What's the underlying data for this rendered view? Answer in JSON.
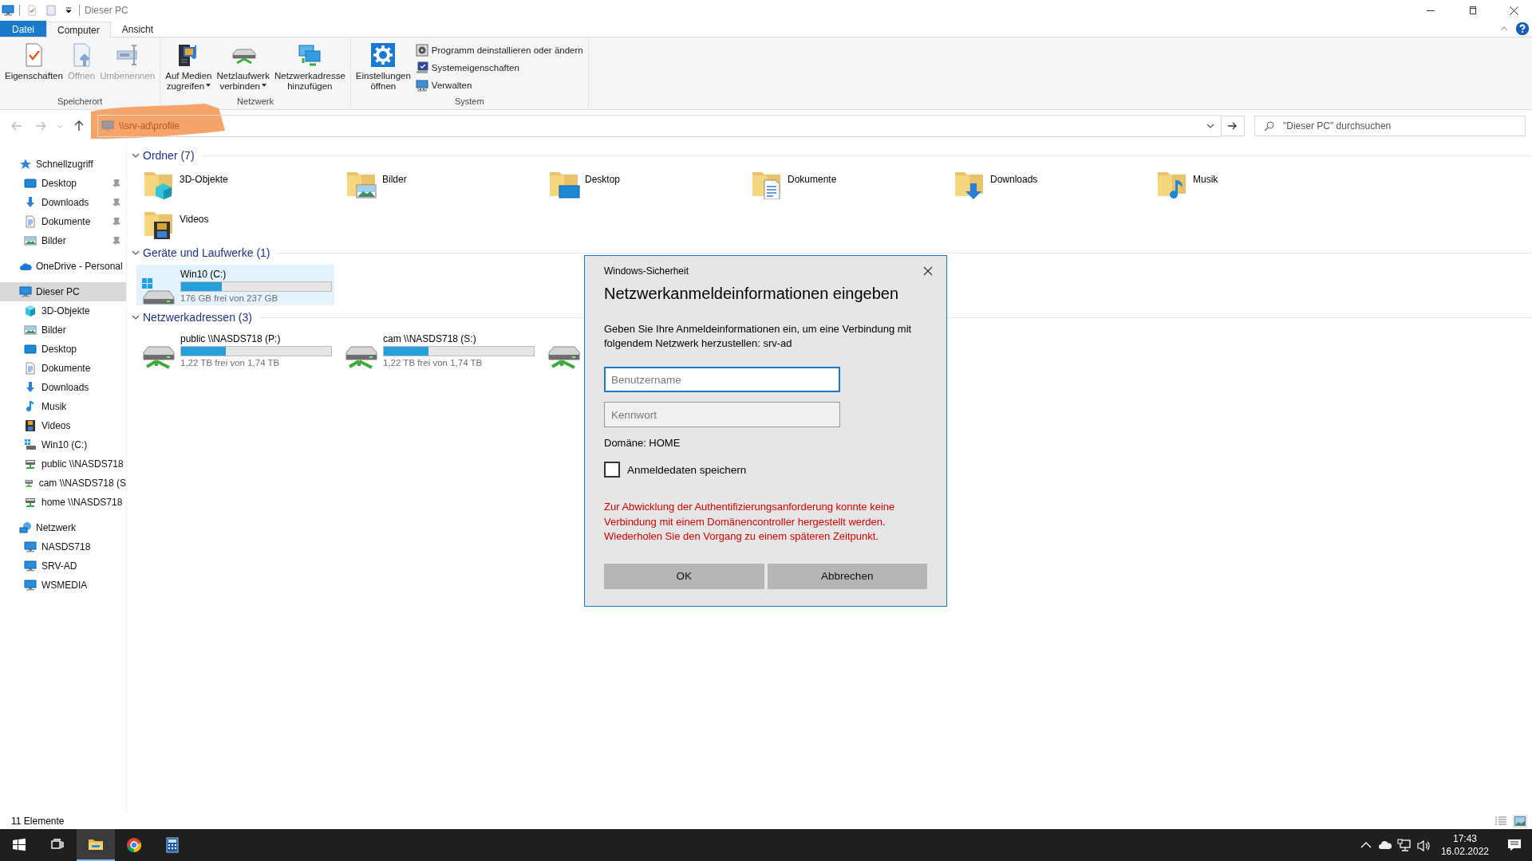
{
  "title_bar": {
    "title": "Dieser PC"
  },
  "ribbon_tabs": [
    {
      "label": "Datei",
      "kind": "file",
      "selected": false
    },
    {
      "label": "Computer",
      "kind": "tab",
      "selected": true
    },
    {
      "label": "Ansicht",
      "kind": "tab",
      "selected": false
    }
  ],
  "ribbon_groups": [
    {
      "label": "Speicherort",
      "buttons": [
        {
          "kind": "properties",
          "label": "Eigenschaften",
          "disabled": false,
          "dropdown": false
        },
        {
          "kind": "open",
          "label": "Öffnen",
          "disabled": true,
          "dropdown": false
        },
        {
          "kind": "rename",
          "label": "Umbenennen",
          "disabled": true,
          "dropdown": false
        }
      ]
    },
    {
      "label": "Netzwerk",
      "buttons": [
        {
          "kind": "media",
          "label": "Auf Medien\nzugreifen",
          "disabled": false,
          "dropdown": true
        },
        {
          "kind": "map_drive",
          "label": "Netzlaufwerk\nverbinden",
          "disabled": false,
          "dropdown": true
        },
        {
          "kind": "add_location",
          "label": "Netzwerkadresse\nhinzufügen",
          "disabled": false,
          "dropdown": false
        }
      ]
    },
    {
      "label": "System",
      "buttons": [
        {
          "kind": "settings",
          "label": "Einstellungen\nöffnen",
          "disabled": false,
          "dropdown": false
        }
      ],
      "small_buttons": [
        {
          "kind": "uninstall",
          "label": "Programm deinstallieren oder ändern"
        },
        {
          "kind": "system_props",
          "label": "Systemeigenschaften"
        },
        {
          "kind": "manage",
          "label": "Verwalten"
        }
      ]
    }
  ],
  "navigation": {
    "address": "\\\\srv-ad\\profile",
    "search_placeholder": "\"Dieser PC\" durchsuchen"
  },
  "sidebar": {
    "items": [
      {
        "label": "Schnellzugriff",
        "kind": "quick_access",
        "selected": false,
        "children": [
          {
            "label": "Desktop",
            "kind": "desktop",
            "pinned": true,
            "selected": false
          },
          {
            "label": "Downloads",
            "kind": "downloads",
            "pinned": true,
            "selected": false
          },
          {
            "label": "Dokumente",
            "kind": "documents",
            "pinned": true,
            "selected": false
          },
          {
            "label": "Bilder",
            "kind": "pictures",
            "pinned": true,
            "selected": false
          }
        ]
      },
      {
        "label": "OneDrive - Personal",
        "kind": "onedrive",
        "selected": false
      },
      {
        "label": "Dieser PC",
        "kind": "computer",
        "selected": true,
        "children": [
          {
            "label": "3D-Objekte",
            "kind": "objects3d",
            "pinned": false,
            "selected": false
          },
          {
            "label": "Bilder",
            "kind": "pictures",
            "pinned": false,
            "selected": false
          },
          {
            "label": "Desktop",
            "kind": "desktop",
            "pinned": false,
            "selected": false
          },
          {
            "label": "Dokumente",
            "kind": "documents",
            "pinned": false,
            "selected": false
          },
          {
            "label": "Downloads",
            "kind": "downloads",
            "pinned": false,
            "selected": false
          },
          {
            "label": "Musik",
            "kind": "music",
            "pinned": false,
            "selected": false
          },
          {
            "label": "Videos",
            "kind": "videos",
            "pinned": false,
            "selected": false
          },
          {
            "label": "Win10 (C:)",
            "kind": "local_drive",
            "pinned": false,
            "selected": false
          },
          {
            "label": "public \\\\NASDS718",
            "kind": "net_drive",
            "pinned": false,
            "selected": false
          },
          {
            "label": "cam \\\\NASDS718 (S",
            "kind": "net_drive",
            "pinned": false,
            "selected": false
          },
          {
            "label": "home \\\\NASDS718",
            "kind": "net_drive",
            "pinned": false,
            "selected": false
          }
        ]
      },
      {
        "label": "Netzwerk",
        "kind": "network",
        "selected": false,
        "children": [
          {
            "label": "NASDS718",
            "kind": "computer",
            "pinned": false,
            "selected": false
          },
          {
            "label": "SRV-AD",
            "kind": "computer",
            "pinned": false,
            "selected": false
          },
          {
            "label": "WSMEDIA",
            "kind": "computer",
            "pinned": false,
            "selected": false
          }
        ]
      }
    ]
  },
  "sections": [
    {
      "title": "Ordner (7)",
      "kind": "folders",
      "items": [
        {
          "label": "3D-Objekte",
          "kind": "objects3d"
        },
        {
          "label": "Bilder",
          "kind": "pictures"
        },
        {
          "label": "Desktop",
          "kind": "desktop"
        },
        {
          "label": "Dokumente",
          "kind": "documents"
        },
        {
          "label": "Downloads",
          "kind": "downloads"
        },
        {
          "label": "Musik",
          "kind": "music"
        },
        {
          "label": "Videos",
          "kind": "videos"
        }
      ]
    },
    {
      "title": "Geräte und Laufwerke (1)",
      "kind": "drives",
      "items": [
        {
          "kind": "local_drive",
          "label": "Win10 (C:)",
          "free": "176 GB frei von 237 GB",
          "level": 0.27,
          "selected": true
        }
      ]
    },
    {
      "title": "Netzwerkadressen (3)",
      "kind": "drives",
      "items": [
        {
          "kind": "net_drive",
          "label": "public \\\\NASDS718 (P:)",
          "free": "1,22 TB frei von 1,74 TB",
          "level": 0.3,
          "selected": false
        },
        {
          "kind": "net_drive",
          "label": "cam \\\\NASDS718 (S:)",
          "free": "1,22 TB frei von 1,74 TB",
          "level": 0.3,
          "selected": false
        },
        {
          "kind": "net_drive_covered"
        }
      ]
    }
  ],
  "status_bar": {
    "count": "11 Elemente",
    "view_buttons": [
      {
        "kind": "details",
        "selected": false
      },
      {
        "kind": "tiles",
        "selected": true
      }
    ]
  },
  "taskbar": {
    "apps": [
      {
        "kind": "start",
        "selected": false
      },
      {
        "kind": "task_view",
        "selected": false
      },
      {
        "kind": "explorer",
        "selected": true
      },
      {
        "kind": "browser",
        "selected": false
      },
      {
        "kind": "calculator",
        "selected": false
      }
    ],
    "tray": [
      {
        "kind": "chevron"
      },
      {
        "kind": "cloud"
      },
      {
        "kind": "network"
      },
      {
        "kind": "volume"
      }
    ],
    "time": "17:43",
    "date": "16.02.2022"
  },
  "dialog": {
    "app_title": "Windows-Sicherheit",
    "heading": "Netzwerkanmeldeinformationen eingeben",
    "message": "Geben Sie Ihre Anmeldeinformationen ein, um eine Verbindung mit folgendem Netzwerk herzustellen: srv-ad",
    "fields": [
      {
        "placeholder": "Benutzername",
        "focused": true
      },
      {
        "placeholder": "Kennwort",
        "focused": false
      }
    ],
    "domain": "Domäne: HOME",
    "remember": {
      "label": "Anmeldedaten speichern",
      "checked": false
    },
    "error": "Zur Abwicklung der Authentifizierungsanforderung konnte keine Verbindung mit einem Domänencontroller hergestellt werden. Wiederholen Sie den Vorgang zu einem späteren Zeitpunkt.",
    "buttons": [
      "OK",
      "Abbrechen"
    ]
  }
}
